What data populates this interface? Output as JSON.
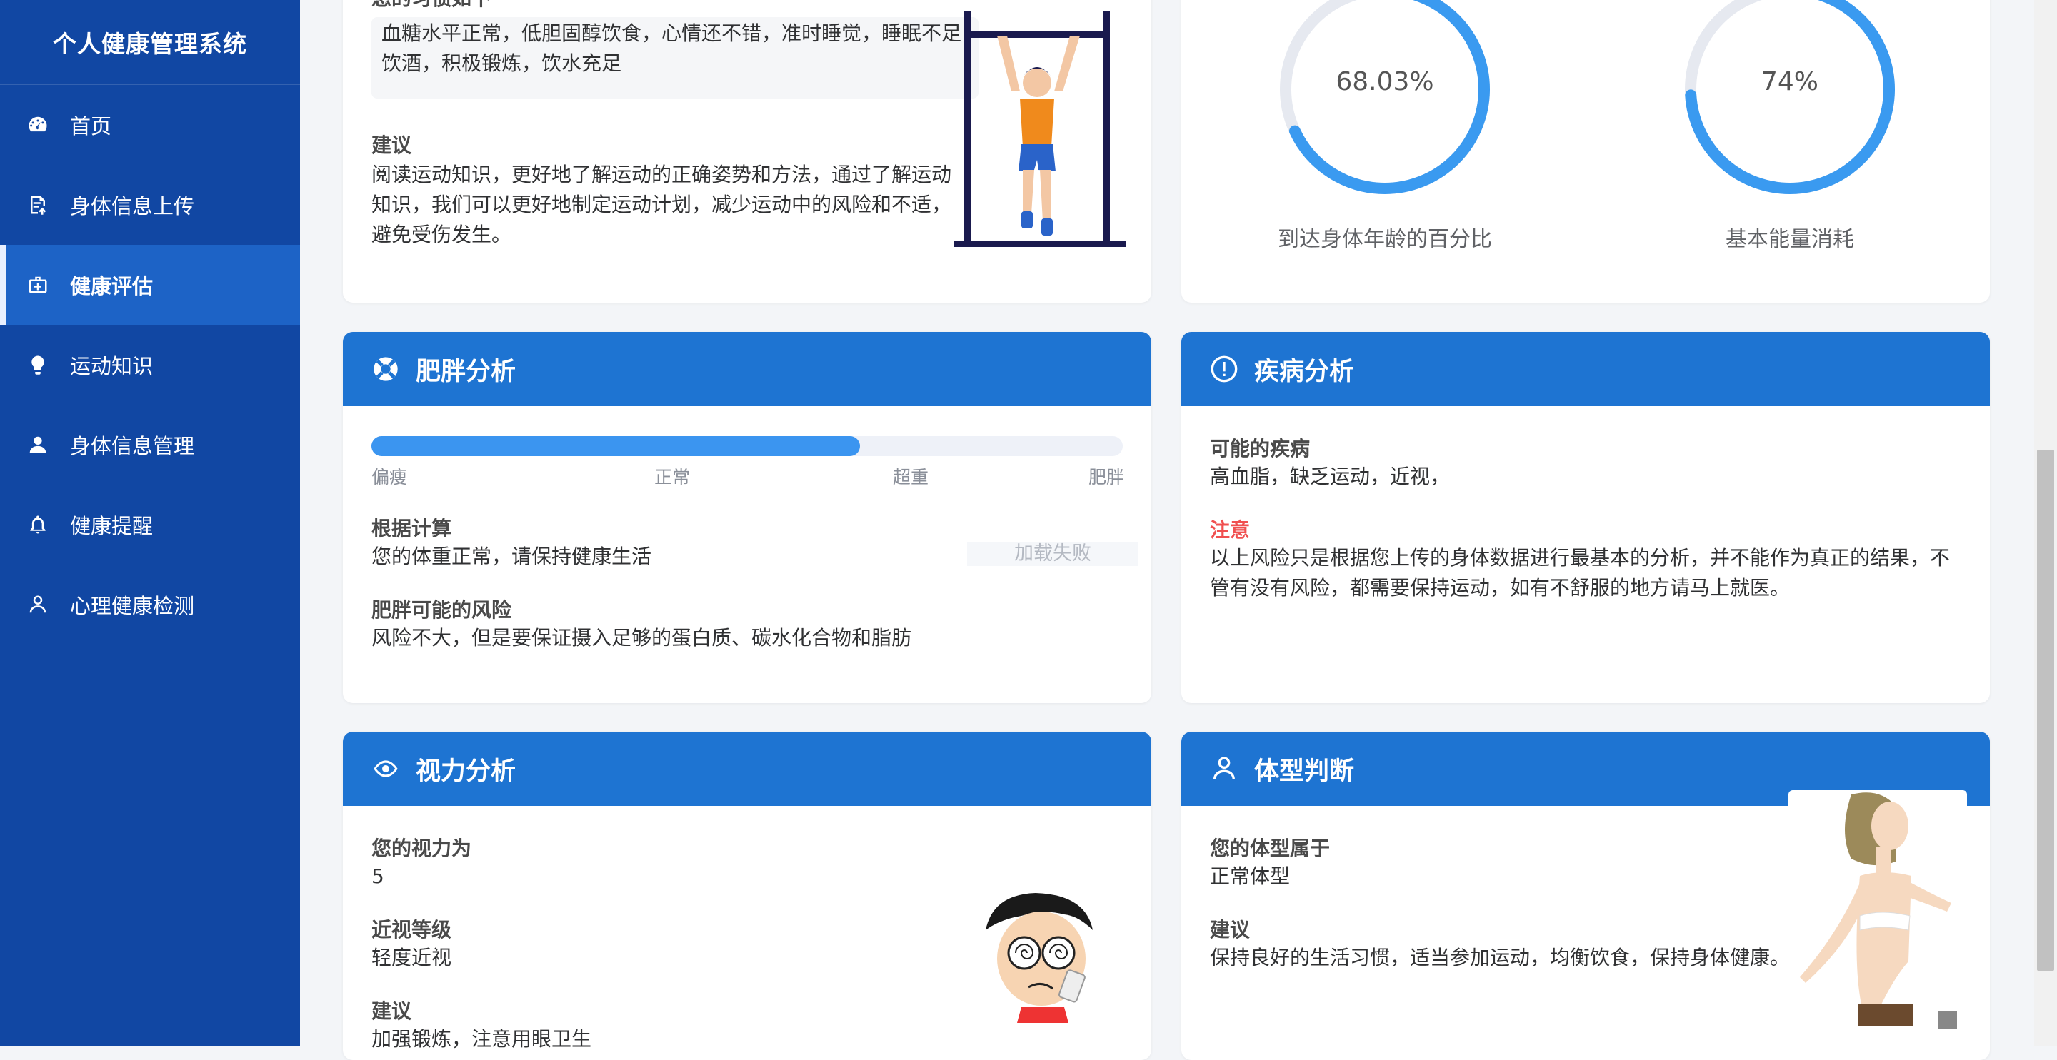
{
  "sidebar": {
    "title": "个人健康管理系统",
    "items": [
      {
        "label": "首页",
        "icon": "dashboard-icon"
      },
      {
        "label": "身体信息上传",
        "icon": "upload-document-icon"
      },
      {
        "label": "健康评估",
        "icon": "medical-kit-icon",
        "active": true
      },
      {
        "label": "运动知识",
        "icon": "lightbulb-icon"
      },
      {
        "label": "身体信息管理",
        "icon": "user-filled-icon"
      },
      {
        "label": "健康提醒",
        "icon": "bell-icon"
      },
      {
        "label": "心理健康检测",
        "icon": "user-outline-icon"
      }
    ]
  },
  "habits_card": {
    "partial_label": "您的习惯如下",
    "habits_text": "血糖水平正常，低胆固醇饮食，心情还不错，准时睡觉，睡眠不足，少饮酒，积极锻炼，饮水充足",
    "advice_label": "建议",
    "advice_text": "阅读运动知识，更好地了解运动的正确姿势和方法，通过了解运动知识，我们可以更好地制定运动计划，减少运动中的风险和不适，避免受伤发生。",
    "illustration": "pull-up-man-illustration"
  },
  "stats_card": {
    "ring1": {
      "value_text": "68.03%",
      "percent": 68.03,
      "label": "到达身体年龄的百分比"
    },
    "ring2": {
      "value_text": "74%",
      "percent": 74,
      "label": "基本能量消耗"
    }
  },
  "obesity_card": {
    "title": "肥胖分析",
    "icon": "lifebuoy-icon",
    "progress_percent": 65,
    "scale": [
      "偏瘦",
      "正常",
      "超重",
      "肥胖"
    ],
    "calc_label": "根据计算",
    "calc_text": "您的体重正常，请保持健康生活",
    "image_failed": "加载失败",
    "risk_label": "肥胖可能的风险",
    "risk_text": "风险不大，但是要保证摄入足够的蛋白质、碳水化合物和脂肪"
  },
  "disease_card": {
    "title": "疾病分析",
    "icon": "alert-circle-icon",
    "possible_label": "可能的疾病",
    "possible_text": "高血脂，缺乏运动，近视，",
    "note_label": "注意",
    "note_color": "#f05050",
    "note_text": "以上风险只是根据您上传的身体数据进行最基本的分析，并不能作为真正的结果，不管有没有风险，都需要保持运动，如有不舒服的地方请马上就医。"
  },
  "vision_card": {
    "title": "视力分析",
    "icon": "eye-icon",
    "vision_label": "您的视力为",
    "vision_value": "5",
    "myopia_label": "近视等级",
    "myopia_value": "轻度近视",
    "advice_label": "建议",
    "advice_text": "加强锻炼，注意用眼卫生",
    "illustration": "dizzy-glasses-boy-illustration"
  },
  "body_card": {
    "title": "体型判断",
    "icon": "user-outline-icon",
    "type_label": "您的体型属于",
    "type_value": "正常体型",
    "advice_label": "建议",
    "advice_text": "保持良好的生活习惯，适当参加运动，均衡饮食，保持身体健康。",
    "illustration": "woman-body-illustration"
  },
  "colors": {
    "sidebar_bg": "#1147a3",
    "sidebar_active": "#1d63c6",
    "header_blue": "#1e74d2",
    "ring_blue": "#3a9af0",
    "ring_track": "#e6e9f0"
  }
}
